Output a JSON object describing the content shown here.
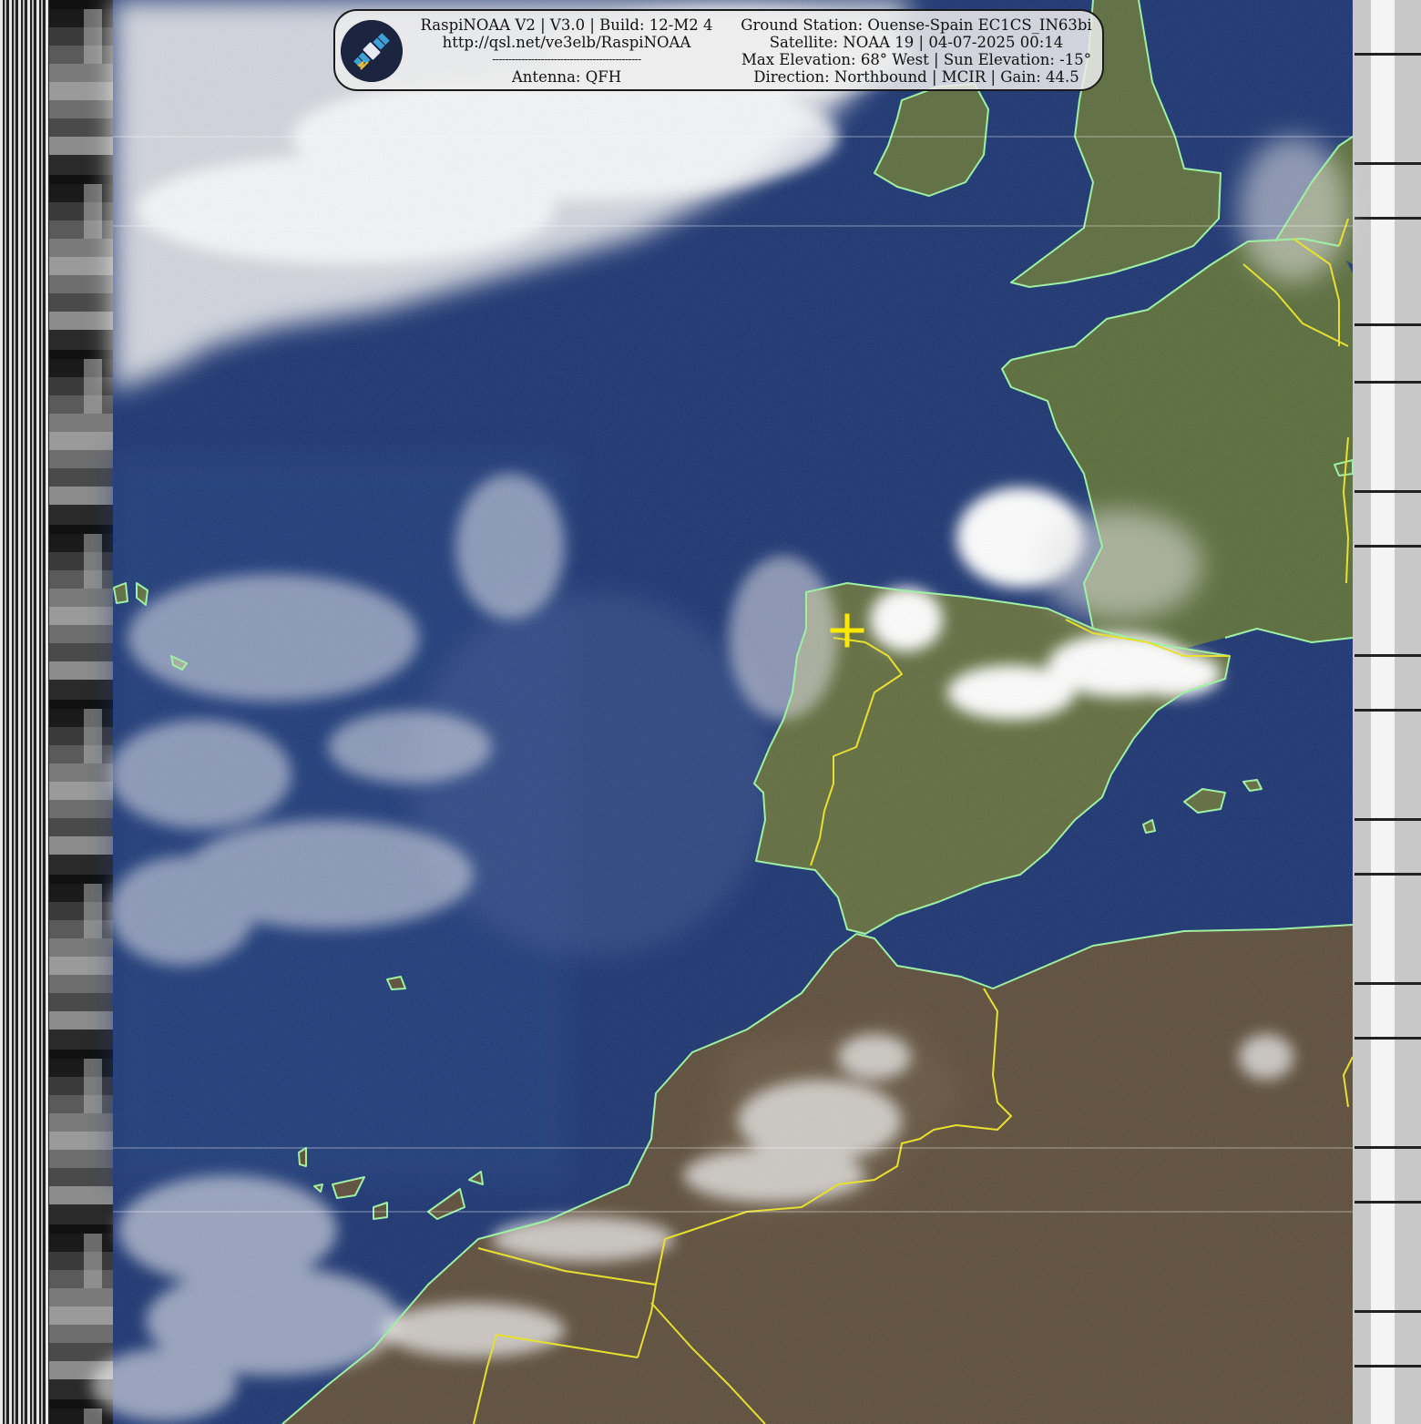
{
  "overlay": {
    "app_line": "RaspiNOAA V2 | V3.0 | Build: 12-M2 4",
    "url": "http://qsl.net/ve3elb/RaspiNOAA",
    "divider": "----------------------------------------------",
    "antenna": "Antenna: QFH",
    "ground_station": "Ground Station: Ouense-Spain EC1CS_IN63bi",
    "satellite": "Satellite: NOAA 19 | 04-07-2025 00:14",
    "elevation": "Max Elevation: 68° West | Sun Elevation: -15°",
    "direction": "Direction: Northbound | MCIR | Gain: 44.5"
  },
  "logo_icon": "satellite-icon",
  "colors": {
    "ocean": "#16306e",
    "land_green": "#5a6a38",
    "land_desert": "#5a4a36",
    "coastline": "#9ef0a4",
    "borders": "#e8e030",
    "station_marker": "#ffe800",
    "cloud": "#f2f2f2"
  }
}
